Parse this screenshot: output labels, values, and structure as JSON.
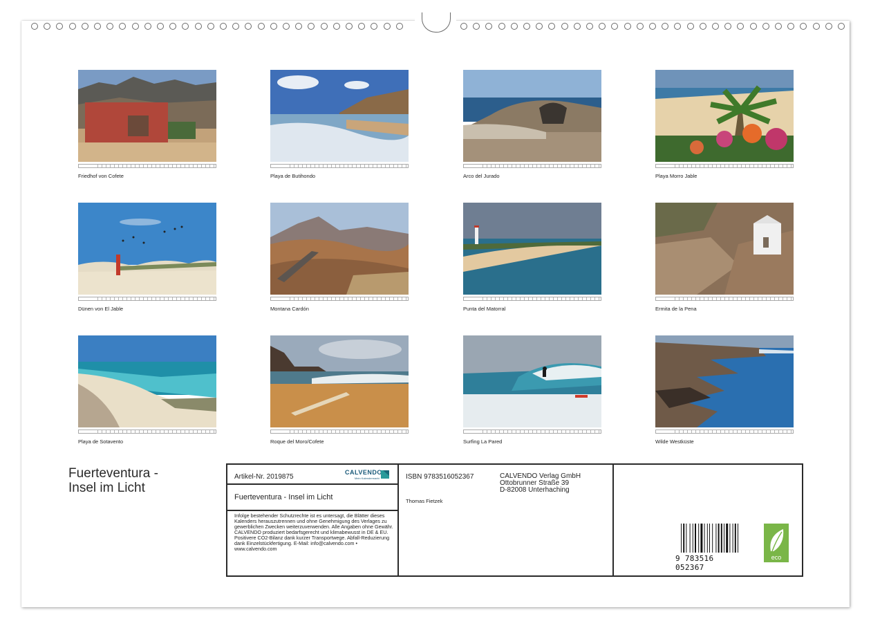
{
  "photos": [
    {
      "caption": "Friedhof von Cofete"
    },
    {
      "caption": "Playa de Butihondo"
    },
    {
      "caption": "Arco del Jurado"
    },
    {
      "caption": "Playa Morro Jable"
    },
    {
      "caption": "Dünen von El Jable"
    },
    {
      "caption": "Montana Cardón"
    },
    {
      "caption": "Punta del Matorral"
    },
    {
      "caption": "Ermita de la Pena"
    },
    {
      "caption": "Playa de Sotavento"
    },
    {
      "caption": "Roque del Moro/Cofete"
    },
    {
      "caption": "Surfing La Pared"
    },
    {
      "caption": "Wilde Westküste"
    }
  ],
  "title": {
    "line1": "Fuerteventura -",
    "line2": "Insel im Licht"
  },
  "info": {
    "article": "Artikel-Nr. 2019875",
    "logo": "CALVENDO",
    "logo_sub": "Mein Kalendermarkt",
    "calendar_title": "Fuerteventura - Insel im Licht",
    "legal": "Infolge bestehender Schutzrechte ist es untersagt, die Blätter dieses Kalenders herauszutrennen und ohne Genehmigung des Verlages zu gewerblichen Zwecken weiterzuverwenden. Alle Angaben ohne Gewähr. CALVENDO produziert bedarfsgerecht und klimabewusst in DE & EU. Positivere CO2-Bilanz dank kurzer Transportwege. Abfall-Reduzierung dank Einzelstückfertigung. E-Mail: info@calvendo.com • www.calvendo.com",
    "isbn": "ISBN 9783516052367",
    "author": "Thomas Fietzek",
    "publisher_name": "CALVENDO Verlag GmbH",
    "publisher_street": "Ottobrunner Straße 39",
    "publisher_city": "D-82008 Unterhaching",
    "barcode_digits": "9 783516 052367",
    "eco_label": "eco"
  }
}
